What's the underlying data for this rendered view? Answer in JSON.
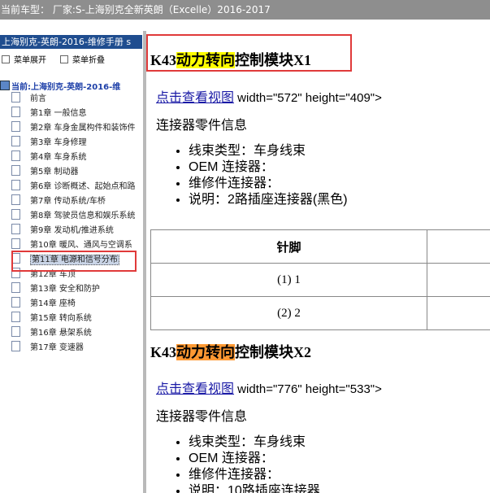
{
  "window": {
    "title": "当前车型： 厂家:S-上海别克全新英朗（Excelle）2016-2017"
  },
  "sidebar": {
    "book_header": "上海别克-英朗-2016-维修手册 s",
    "expand_label": "菜单展开",
    "collapse_label": "菜单折叠",
    "current_label": "当前:上海别克-英朗-2016-维",
    "items": [
      {
        "label": "前言"
      },
      {
        "label": "第1章 一般信息"
      },
      {
        "label": "第2章 车身金属构件和装饰件"
      },
      {
        "label": "第3章 车身修理"
      },
      {
        "label": "第4章 车身系统"
      },
      {
        "label": "第5章 制动器"
      },
      {
        "label": "第6章 诊断概述、起始点和路"
      },
      {
        "label": "第7章 传动系统/车桥"
      },
      {
        "label": "第8章 驾驶员信息和娱乐系统"
      },
      {
        "label": "第9章 发动机/推进系统"
      },
      {
        "label": "第10章 暖风、通风与空调系"
      },
      {
        "label": "第11章 电源和信号分布"
      },
      {
        "label": "第12章 车顶"
      },
      {
        "label": "第13章 安全和防护"
      },
      {
        "label": "第14章 座椅"
      },
      {
        "label": "第15章 转向系统"
      },
      {
        "label": "第16章 悬架系统"
      },
      {
        "label": "第17章 变速器"
      }
    ],
    "selected_index": 11
  },
  "main": {
    "section1": {
      "title_prefix": "K43",
      "title_highlight": "动力转向",
      "title_suffix": "控制模块X1",
      "view_link": "点击查看视图",
      "view_attrs": " width=\"572\" height=\"409\">",
      "connector_info": "连接器零件信息",
      "bullets": [
        "线束类型：车身线束",
        "OEM 连接器：",
        "维修件连接器：",
        "说明：2路插座连接器(黑色)"
      ],
      "table": {
        "headers": [
          "针脚",
          ""
        ],
        "rows": [
          [
            "(1) 1",
            ""
          ],
          [
            "(2) 2",
            ""
          ]
        ]
      }
    },
    "section2": {
      "title_prefix": "K43",
      "title_highlight": "动力转向",
      "title_suffix": "控制模块X2",
      "view_link": "点击查看视图",
      "view_attrs": " width=\"776\" height=\"533\">",
      "connector_info": "连接器零件信息",
      "bullets": [
        "线束类型：车身线束",
        "OEM 连接器：",
        "维修件连接器：",
        "说明：10路插座连接器"
      ]
    }
  },
  "colors": {
    "highlight_yellow": "#ffff00",
    "highlight_orange": "#ff9933",
    "annotation_red": "#e03a3a"
  }
}
